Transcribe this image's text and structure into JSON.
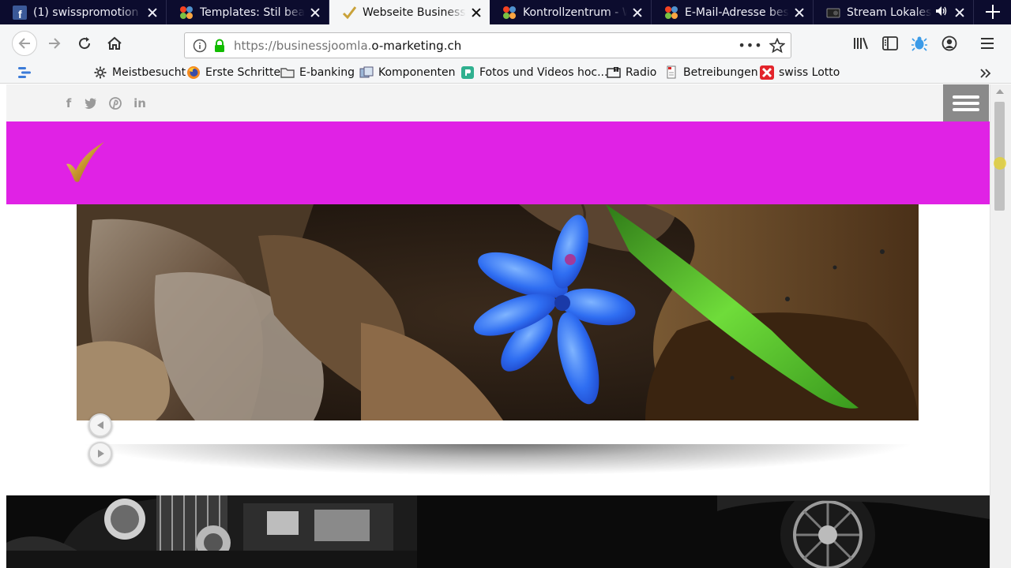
{
  "tabs": [
    {
      "title": "(1) swisspromotion",
      "icon": "facebook-icon",
      "active": false
    },
    {
      "title": "Templates: Stil bearbeiten",
      "icon": "joomla-icon",
      "active": false
    },
    {
      "title": "Webseite Business für",
      "icon": "checkmark-icon",
      "active": true
    },
    {
      "title": "Kontrollzentrum - Webseite",
      "icon": "joomla-icon",
      "active": false
    },
    {
      "title": "E-Mail-Adresse bestätigen",
      "icon": "joomla-icon",
      "active": false
    },
    {
      "title": "Stream Lokales Radio",
      "icon": "radio-icon",
      "active": false
    }
  ],
  "url": {
    "prefix": "https://businessjoomla.",
    "domain": "o-marketing.ch"
  },
  "url_more": "•••",
  "bookmarks": [
    {
      "label": "Meistbesucht",
      "icon": "gear-icon"
    },
    {
      "label": "Erste Schritte",
      "icon": "firefox-icon"
    },
    {
      "label": "E-banking",
      "icon": "folder-icon"
    },
    {
      "label": "Komponenten",
      "icon": "components-icon"
    },
    {
      "label": "Fotos und Videos hoc...",
      "icon": "photo-icon"
    },
    {
      "label": "Radio",
      "icon": "radio-icon"
    },
    {
      "label": "Betreibungen",
      "icon": "document-icon"
    },
    {
      "label": "swiss Lotto",
      "icon": "lotto-icon"
    }
  ],
  "social": [
    {
      "glyph": "f",
      "icon": "facebook-icon"
    },
    {
      "glyph": "t",
      "icon": "twitter-icon"
    },
    {
      "glyph": "p",
      "icon": "pinterest-icon"
    },
    {
      "glyph": "in",
      "icon": "linkedin-icon"
    }
  ],
  "colors": {
    "header": "#e022e5",
    "tabstrip": "#0c0c2e",
    "menu_accent": "#8e1a6f"
  }
}
